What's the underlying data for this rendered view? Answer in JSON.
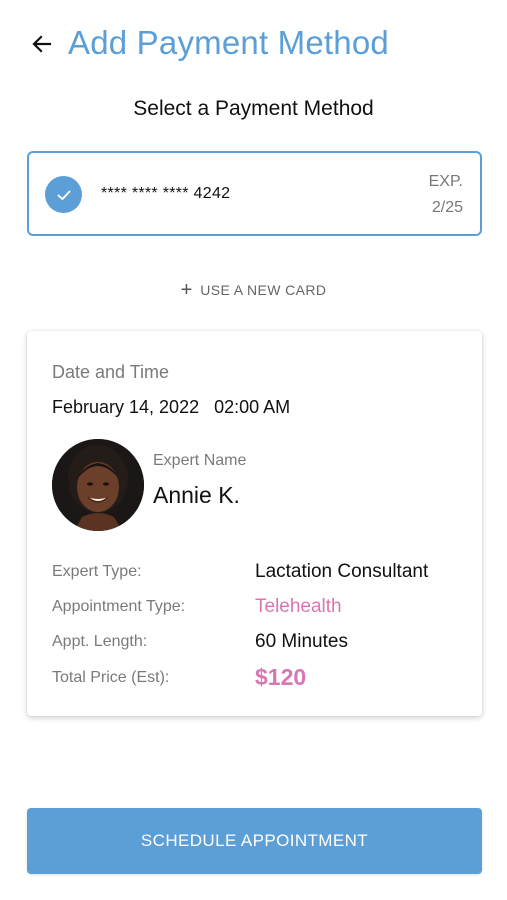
{
  "header": {
    "title": "Add Payment Method",
    "back_icon": "arrow-left-icon"
  },
  "payment": {
    "heading": "Select a Payment Method",
    "selected_card": {
      "number": "**** **** **** 4242",
      "exp_label": "EXP.",
      "exp_value": "2/25",
      "selected": true
    },
    "new_card": {
      "icon": "plus-icon",
      "label": "USE A NEW CARD"
    }
  },
  "appointment": {
    "date_time_label": "Date and Time",
    "date_time_value": "February 14, 2022   02:00 AM",
    "expert_label": "Expert Name",
    "expert_name": "Annie K.",
    "details": [
      {
        "label": "Expert Type:",
        "value": "Lactation Consultant"
      },
      {
        "label": "Appointment Type:",
        "value": "Telehealth"
      },
      {
        "label": "Appt. Length:",
        "value": "60 Minutes"
      },
      {
        "label": "Total Price (Est):",
        "value": "$120"
      }
    ]
  },
  "actions": {
    "schedule_label": "SCHEDULE APPOINTMENT"
  },
  "colors": {
    "primary": "#5b9fd6",
    "accent_pink": "#d877b4"
  }
}
